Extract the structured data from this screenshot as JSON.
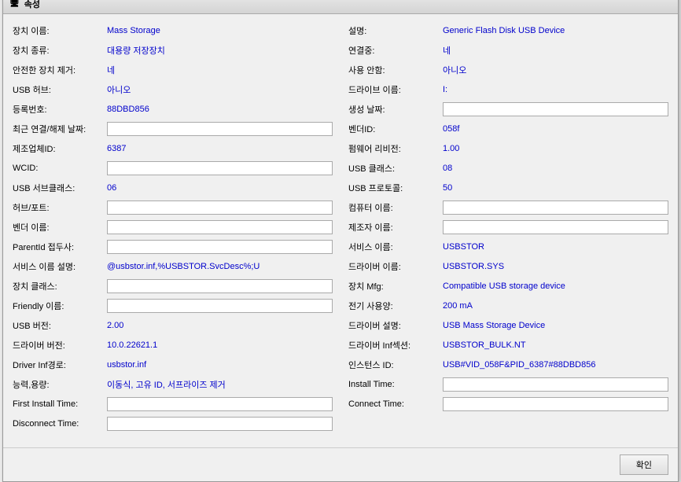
{
  "window": {
    "title": "속성"
  },
  "left": {
    "rows": [
      {
        "label": "장치 이름:",
        "value": "Mass Storage",
        "type": "link"
      },
      {
        "label": "장치 종류:",
        "value": "대용량 저장장치",
        "type": "link"
      },
      {
        "label": "안전한 장치 제거:",
        "value": "네",
        "type": "link"
      },
      {
        "label": "USB 허브:",
        "value": "아니오",
        "type": "link"
      },
      {
        "label": "등록번호:",
        "value": "88DBD856",
        "type": "link"
      },
      {
        "label": "최근 연결/해제 날짜:",
        "value": "",
        "type": "input"
      },
      {
        "label": "제조업체ID:",
        "value": "6387",
        "type": "link"
      },
      {
        "label": "WCID:",
        "value": "",
        "type": "empty"
      },
      {
        "label": "USB 서브클래스:",
        "value": "06",
        "type": "link"
      },
      {
        "label": "허브/포트:",
        "value": "",
        "type": "empty"
      },
      {
        "label": "벤더 이름:",
        "value": "",
        "type": "empty"
      },
      {
        "label": "ParentId 접두사:",
        "value": "",
        "type": "empty"
      },
      {
        "label": "서비스 이름 설명:",
        "value": "@usbstor.inf,%USBSTOR.SvcDesc%;U",
        "type": "link"
      },
      {
        "label": "장치 클래스:",
        "value": "",
        "type": "empty"
      },
      {
        "label": "Friendly 이름:",
        "value": "",
        "type": "empty"
      },
      {
        "label": "USB 버전:",
        "value": "2.00",
        "type": "link"
      },
      {
        "label": "드라이버 버전:",
        "value": "10.0.22621.1",
        "type": "link"
      },
      {
        "label": "Driver Inf경로:",
        "value": "usbstor.inf",
        "type": "link"
      },
      {
        "label": "능력,용량:",
        "value": "이동식, 고유 ID, 서프라이즈 제거",
        "type": "link"
      },
      {
        "label": "First Install Time:",
        "value": "",
        "type": "empty"
      },
      {
        "label": "Disconnect Time:",
        "value": "",
        "type": "empty"
      }
    ]
  },
  "right": {
    "rows": [
      {
        "label": "설명:",
        "value": "Generic Flash Disk USB Device",
        "type": "link"
      },
      {
        "label": "연결중:",
        "value": "네",
        "type": "link"
      },
      {
        "label": "사용 안함:",
        "value": "아니오",
        "type": "link"
      },
      {
        "label": "드라이브 이름:",
        "value": "I:",
        "type": "link"
      },
      {
        "label": "생성 날짜:",
        "value": "",
        "type": "input"
      },
      {
        "label": "벤더ID:",
        "value": "058f",
        "type": "link"
      },
      {
        "label": "펌웨어 리비전:",
        "value": "1.00",
        "type": "link"
      },
      {
        "label": "USB 클래스:",
        "value": "08",
        "type": "link"
      },
      {
        "label": "USB 프로토콜:",
        "value": "50",
        "type": "link"
      },
      {
        "label": "컴퓨터 이름:",
        "value": "",
        "type": "input"
      },
      {
        "label": "제조자 이름:",
        "value": "",
        "type": "empty"
      },
      {
        "label": "서비스 이름:",
        "value": "USBSTOR",
        "type": "link"
      },
      {
        "label": "드라이버 이름:",
        "value": "USBSTOR.SYS",
        "type": "link"
      },
      {
        "label": "장치 Mfg:",
        "value": "Compatible USB storage device",
        "type": "link"
      },
      {
        "label": "전기 사용양:",
        "value": "200 mA",
        "type": "link"
      },
      {
        "label": "드라이버 설명:",
        "value": "USB Mass Storage Device",
        "type": "link"
      },
      {
        "label": "드라이버 Inf섹션:",
        "value": "USBSTOR_BULK.NT",
        "type": "link"
      },
      {
        "label": "인스턴스 ID:",
        "value": "USB#VID_058F&PID_6387#88DBD856",
        "type": "link"
      },
      {
        "label": "Install Time:",
        "value": "",
        "type": "empty"
      },
      {
        "label": "Connect Time:",
        "value": "",
        "type": "empty"
      }
    ]
  },
  "footer": {
    "ok_label": "확인"
  }
}
